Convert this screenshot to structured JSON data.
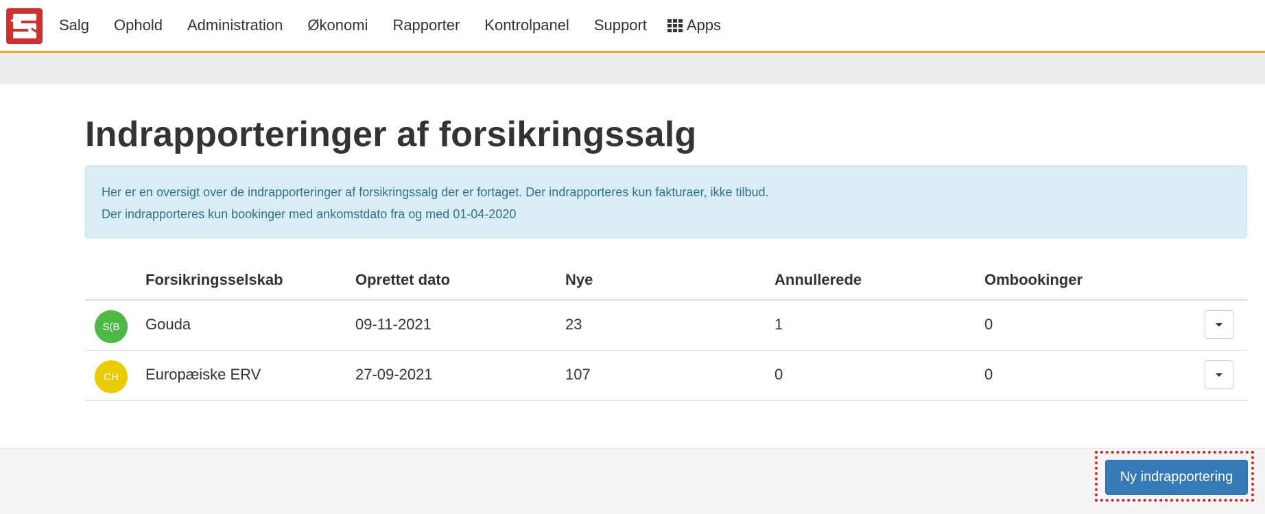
{
  "nav": {
    "items": [
      "Salg",
      "Ophold",
      "Administration",
      "Økonomi",
      "Rapporter",
      "Kontrolpanel",
      "Support"
    ],
    "apps_label": "Apps",
    "apps_icon": "grid-icon"
  },
  "logo_icon": "exchange-arrows-logo",
  "page": {
    "title": "Indrapporteringer af forsikringssalg",
    "info_line1": "Her er en oversigt over de indrapporteringer af forsikringssalg der er fortaget. Der indrapporteres kun fakturaer, ikke tilbud.",
    "info_line2": "Der indrapporteres kun bookinger med ankomstdato fra og med 01-04-2020"
  },
  "table": {
    "headers": [
      "Forsikringsselskab",
      "Oprettet dato",
      "Nye",
      "Annullerede",
      "Ombookinger"
    ],
    "rows": [
      {
        "avatar": "S(B",
        "avatar_color": "#4cb944",
        "company": "Gouda",
        "date": "09-11-2021",
        "new": "23",
        "cancelled": "1",
        "rebookings": "0"
      },
      {
        "avatar": "CH",
        "avatar_color": "#e8cc00",
        "company": "Europæiske ERV",
        "date": "27-09-2021",
        "new": "107",
        "cancelled": "0",
        "rebookings": "0"
      }
    ]
  },
  "footer": {
    "new_button": "Ny indrapportering"
  },
  "colors": {
    "accent": "#f0ad2b",
    "brand": "#d32f2f",
    "primary": "#337ab7",
    "info_bg": "#d9edf7",
    "highlight": "#e02020"
  }
}
